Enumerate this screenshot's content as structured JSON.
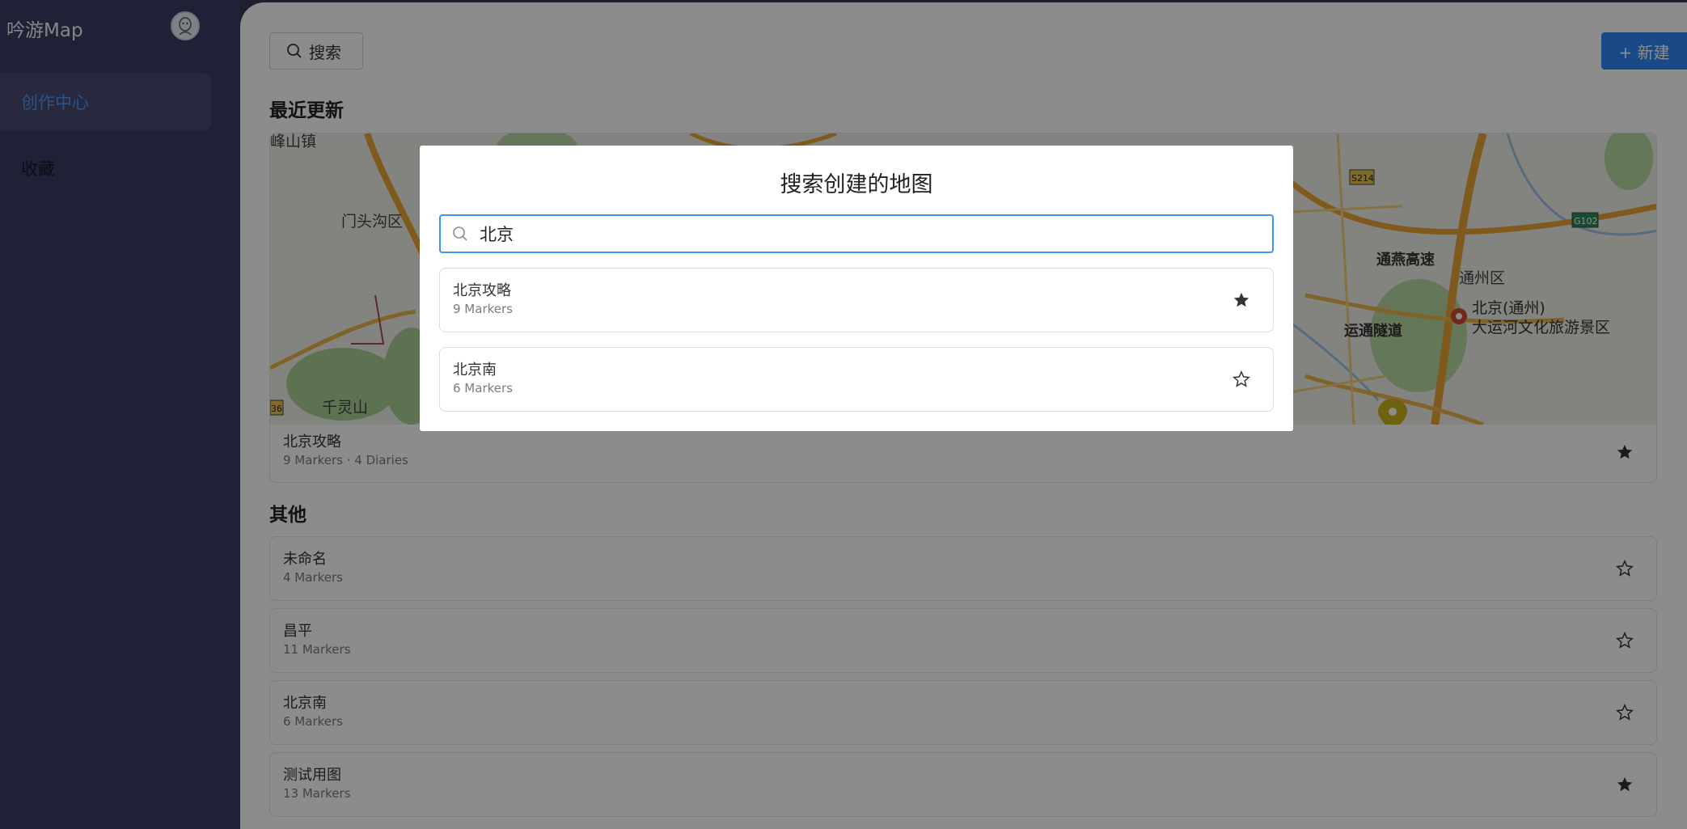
{
  "app": {
    "title": "吟游Map"
  },
  "sidebar": {
    "items": [
      {
        "label": "创作中心",
        "active": true
      },
      {
        "label": "收藏",
        "active": false
      }
    ]
  },
  "header": {
    "search_label": "搜索",
    "new_label": "+ 新建"
  },
  "sections": {
    "recent_title": "最近更新",
    "others_title": "其他"
  },
  "recent": {
    "title": "北京攻略",
    "subtitle": "9 Markers · 4 Diaries",
    "starred": true,
    "map_labels": [
      "峰山镇",
      "门头沟区",
      "千灵山",
      "通燕高速",
      "通州区",
      "北京(通州)",
      "大运河文化旅游景区",
      "运通隧道",
      "S214",
      "G102",
      "36"
    ]
  },
  "others": [
    {
      "title": "未命名",
      "subtitle": "4 Markers",
      "starred": false
    },
    {
      "title": "昌平",
      "subtitle": "11 Markers",
      "starred": false
    },
    {
      "title": "北京南",
      "subtitle": "6 Markers",
      "starred": false
    },
    {
      "title": "测试用图",
      "subtitle": "13 Markers",
      "starred": true
    }
  ],
  "modal": {
    "title": "搜索创建的地图",
    "search_value": "北京",
    "results": [
      {
        "title": "北京攻略",
        "subtitle": "9 Markers",
        "starred": true
      },
      {
        "title": "北京南",
        "subtitle": "6 Markers",
        "starred": false
      }
    ]
  },
  "colors": {
    "sidebar": "#3b3c63",
    "accent": "#2f86f5",
    "active_text": "#4f96f0"
  }
}
